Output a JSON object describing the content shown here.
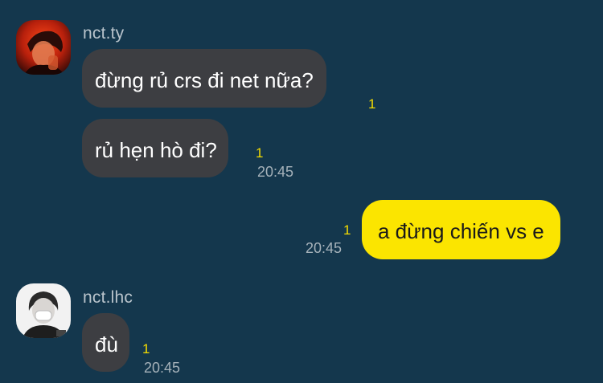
{
  "messages": {
    "m1": {
      "sender": "nct.ty",
      "text": "đừng rủ crs đi net nữa?",
      "unread": "1"
    },
    "m2": {
      "text": "rủ hẹn hò đi?",
      "unread": "1",
      "time": "20:45"
    },
    "m3": {
      "text": "a đừng chiến vs e",
      "unread": "1",
      "time": "20:45"
    },
    "m4": {
      "sender": "nct.lhc",
      "text": "đù",
      "unread": "1",
      "time": "20:45"
    }
  },
  "colors": {
    "background": "#14374d",
    "incoming_bubble": "#3d3e42",
    "outgoing_bubble": "#fbe500",
    "unread_count": "#f5dc00"
  },
  "icons": [
    "avatar-nct-ty",
    "avatar-nct-lhc"
  ]
}
